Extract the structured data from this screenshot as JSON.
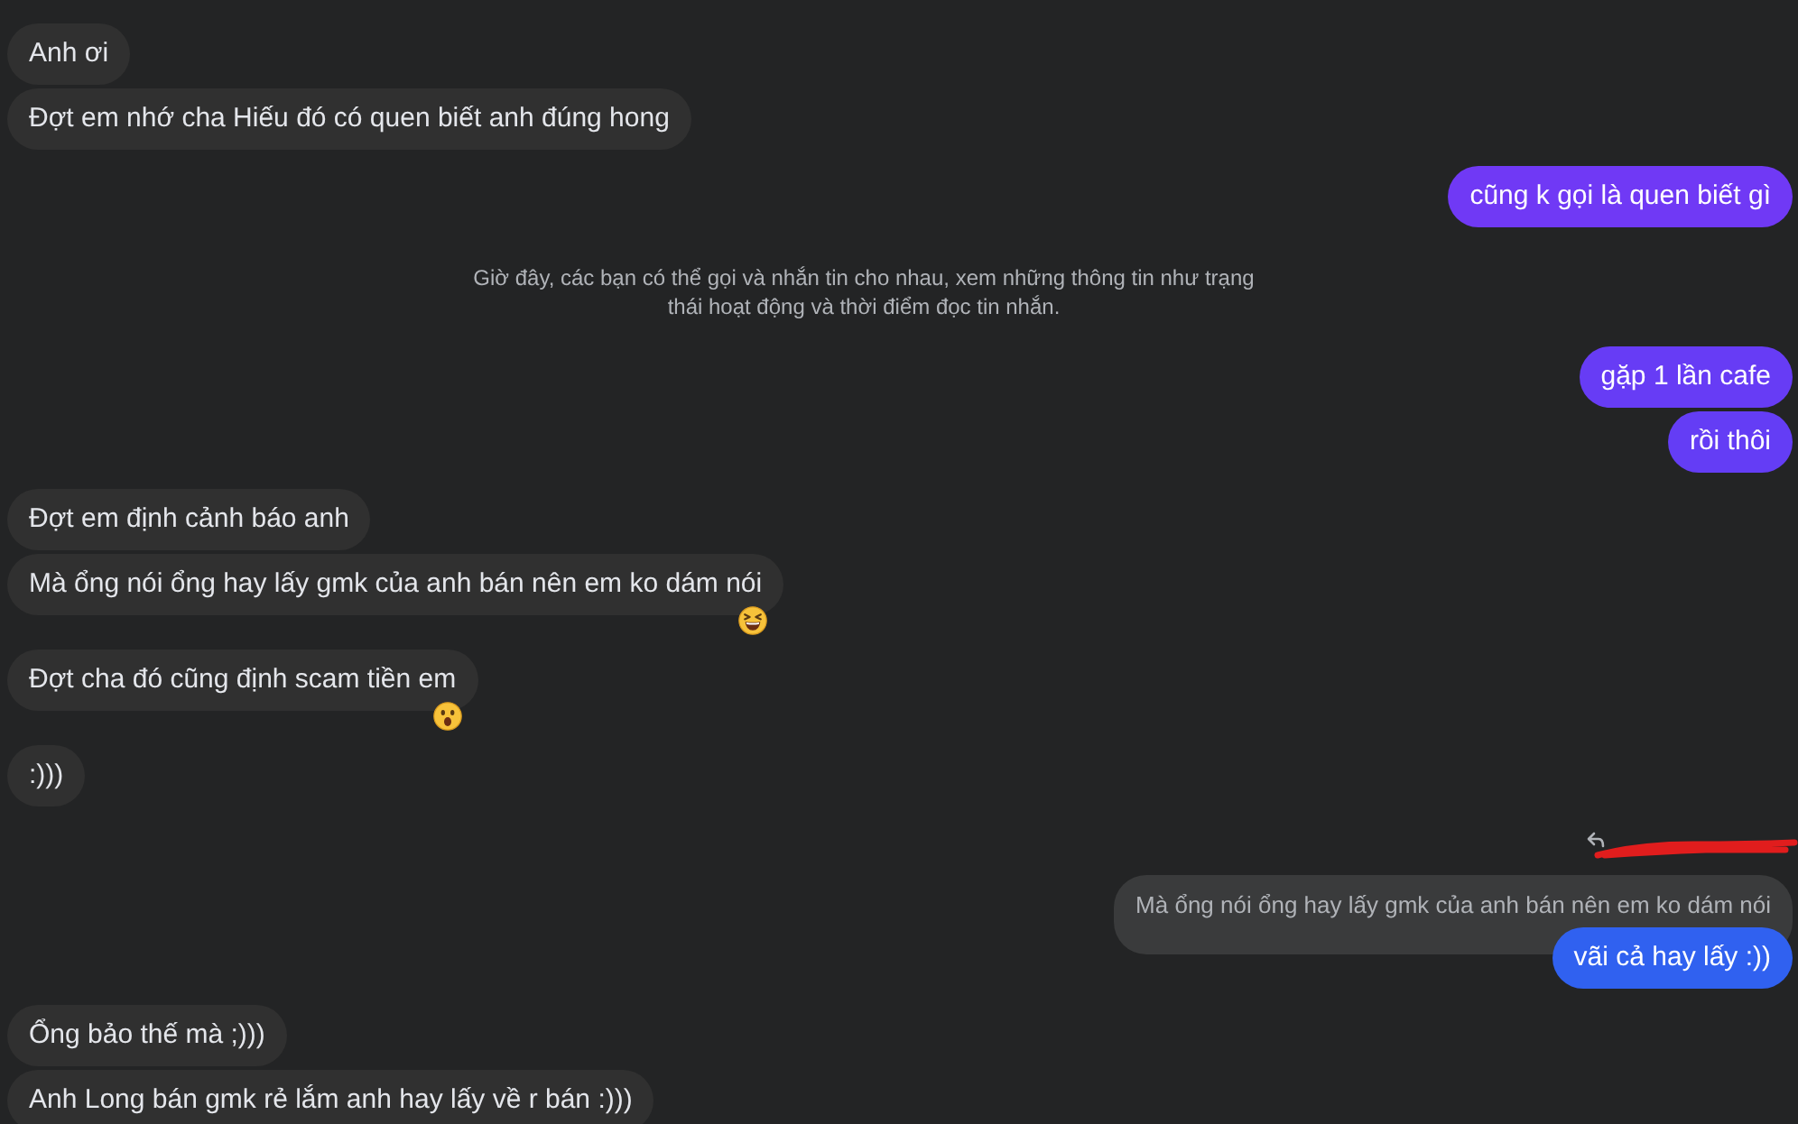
{
  "conversation": [
    {
      "kind": "incoming",
      "messages": [
        {
          "text": "Anh ơi"
        },
        {
          "text": "Đợt em nhớ cha Hiếu đó có quen biết anh đúng hong"
        }
      ]
    },
    {
      "kind": "outgoing",
      "messages": [
        {
          "text": "cũng k gọi là quen biết gì",
          "color": "#7039f5"
        }
      ]
    },
    {
      "kind": "notice",
      "text": "Giờ đây, các bạn có thể gọi và nhắn tin cho nhau, xem những thông tin như trạng thái hoạt động và thời điểm đọc tin nhắn."
    },
    {
      "kind": "outgoing",
      "messages": [
        {
          "text": "gặp 1 lần cafe",
          "color": "#673cf5"
        },
        {
          "text": "rồi thôi",
          "color": "#643df5"
        }
      ]
    },
    {
      "kind": "incoming",
      "messages": [
        {
          "text": "Đợt em định cảnh báo anh"
        },
        {
          "text": "Mà ổng nói ổng hay lấy gmk của anh bán nên em ko dám nói",
          "reaction": {
            "kind": "laugh"
          }
        },
        {
          "text": "Đợt cha đó cũng định scam tiền em",
          "reaction": {
            "kind": "wow"
          }
        },
        {
          "text": ":)))"
        }
      ]
    },
    {
      "kind": "outgoing",
      "messages": [
        {
          "text": "vãi cả hay lấy :))",
          "color": "#3061f0",
          "reply_to": {
            "text": "Mà ổng nói ổng hay lấy gmk của anh bán nên em ko dám nói",
            "redacted": true
          }
        }
      ]
    },
    {
      "kind": "incoming",
      "messages": [
        {
          "text": "Ổng bảo thế mà ;)))"
        },
        {
          "text": "Anh Long bán gmk rẻ lắm anh hay lấy về r bán :)))"
        }
      ]
    }
  ]
}
